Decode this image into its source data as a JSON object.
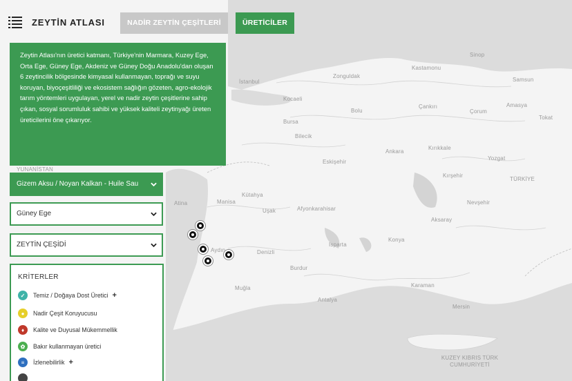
{
  "header": {
    "brand": "ZEYTİN ATLASI",
    "nav_rare_varieties": "NADİR ZEYTİN ÇEŞİTLERİ",
    "nav_producers": "ÜRETİCİLER"
  },
  "info_text": "Zeytin Atlası'nın üretici katmanı, Türkiye'nin Marmara, Kuzey Ege, Orta Ege, Güney Ege, Akdeniz ve Güney Doğu Anadolu'dan oluşan 6 zeytincilik bölgesinde kimyasal kullanmayan, toprağı ve suyu koruyan, biyoçeşitliliği ve ekosistem sağlığın gözeten, agro-ekolojik tarım yöntemleri uygulayan, yerel ve nadir zeytin çeşitlerine sahip çıkan, sosyal sorumluluk sahibi ve yüksek kaliteli zeytinyağı üreten üreticilerini öne çıkarıyor.",
  "filters": {
    "producer": "Gizem Aksu / Noyan Kalkan - Huile Sau",
    "region": "Güney Ege",
    "variety": "ZEYTİN ÇEŞİDİ"
  },
  "criteria": {
    "title": "KRİTERLER",
    "items": [
      {
        "label": "Temiz / Doğaya Dost Üretici",
        "plus": "+",
        "color": "#3fb3a8"
      },
      {
        "label": "Nadir Çeşit Koruyucusu",
        "plus": "",
        "color": "#e6cf2a"
      },
      {
        "label": "Kalite ve Duyusal Mükemmellik",
        "plus": "",
        "color": "#c0392b"
      },
      {
        "label": "Bakır kullanmayan üretici",
        "plus": "",
        "color": "#4caf50"
      },
      {
        "label": "İzlenebilirlik",
        "plus": "+",
        "color": "#2e6fbf"
      }
    ]
  },
  "map": {
    "land_color": "#f3f3f3",
    "sea_color": "#d8d8d8",
    "places": [
      {
        "name": "Kastamonu"
      },
      {
        "name": "Sinop"
      },
      {
        "name": "Samsun"
      },
      {
        "name": "Zonguldak"
      },
      {
        "name": "İstanbul"
      },
      {
        "name": "Kocaeli"
      },
      {
        "name": "Bolu"
      },
      {
        "name": "Çankırı"
      },
      {
        "name": "Çorum"
      },
      {
        "name": "Amasya"
      },
      {
        "name": "Bursa"
      },
      {
        "name": "Bilecik"
      },
      {
        "name": "Tokat"
      },
      {
        "name": "Ankara"
      },
      {
        "name": "Kırıkkale"
      },
      {
        "name": "Eskişehir"
      },
      {
        "name": "Yozgat"
      },
      {
        "name": "Kırşehir"
      },
      {
        "name": "TÜRKİYE"
      },
      {
        "name": "YUNANİSTAN"
      },
      {
        "name": "Nevşehir"
      },
      {
        "name": "Kütahya"
      },
      {
        "name": "Afyonkarahisar"
      },
      {
        "name": "Manisa"
      },
      {
        "name": "Uşak"
      },
      {
        "name": "Aksaray"
      },
      {
        "name": "Konya"
      },
      {
        "name": "Isparta"
      },
      {
        "name": "Aydın"
      },
      {
        "name": "Denizli"
      },
      {
        "name": "Burdur"
      },
      {
        "name": "Muğla"
      },
      {
        "name": "Karaman"
      },
      {
        "name": "Antalya"
      },
      {
        "name": "Mersin"
      },
      {
        "name": "KUZEY KIBRIS TÜRK CUMHURİYETİ"
      },
      {
        "name": "Atina"
      }
    ],
    "pins": 5
  }
}
